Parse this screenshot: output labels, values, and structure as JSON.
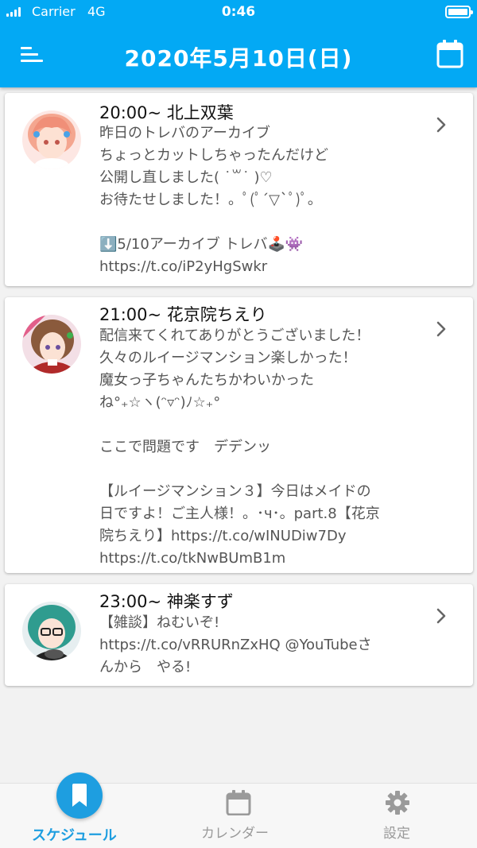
{
  "status_bar": {
    "carrier": "Carrier",
    "network": "4G",
    "time": "0:46"
  },
  "header": {
    "title": "2020年5月10日(日)"
  },
  "schedule": [
    {
      "title": "20:00~ 北上双葉",
      "lines": [
        "昨日のトレバのアーカイブ",
        "ちょっとカットしちゃったんだけど",
        "公開し直しました( ˙꒳˙ )♡",
        "お待たせしました！。ﾟ(ﾟ´▽`ﾟ)ﾟ。",
        "",
        "⬇️5/10アーカイブ トレバ🕹️👾",
        "https://t.co/iP2yHgSwkr"
      ]
    },
    {
      "title": "21:00~ 花京院ちえり",
      "lines": [
        "配信来てくれてありがとうございました！",
        "久々のルイージマンション楽しかった！",
        "魔女っ子ちゃんたちかわいかった",
        "ね°₊☆ヽ(ᵔ▿ᵔ)ﾉ☆₊°",
        "",
        "ここで問題です　デデンッ",
        "",
        "【ルイージマンション３】今日はメイドの",
        "日ですよ！ご主人様！。･ч･。part.8【花京",
        "院ちえり】https://t.co/wINUDiw7Dy",
        "https://t.co/tkNwBUmB1m"
      ]
    },
    {
      "title": "23:00~ 神楽すず",
      "lines": [
        "【雑談】ねむいぞ!",
        "https://t.co/vRRURnZxHQ @YouTubeさ",
        "んから　やる!"
      ]
    }
  ],
  "nav": {
    "tabs": [
      {
        "label": "スケジュール",
        "active": true
      },
      {
        "label": "カレンダー",
        "active": false
      },
      {
        "label": "設定",
        "active": false
      }
    ]
  },
  "colors": {
    "primary": "#03a9f4",
    "active": "#1e9ee0",
    "inactive": "#9a9a9a"
  },
  "icons": [
    "menu-icon",
    "calendar-icon",
    "chevron-right-icon",
    "bookmark-icon",
    "gear-icon"
  ]
}
